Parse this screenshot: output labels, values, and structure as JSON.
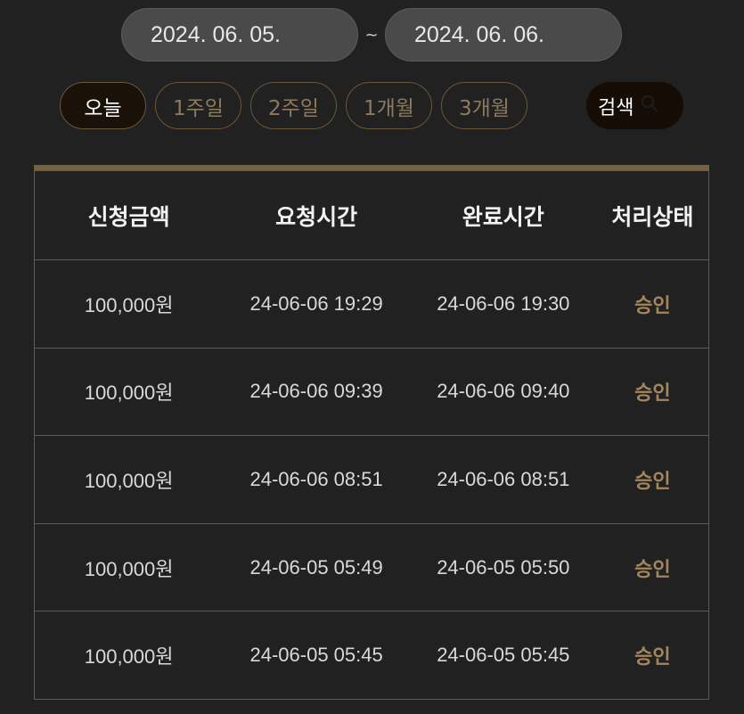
{
  "date_range": {
    "start": "2024. 06. 05.",
    "separator": "~",
    "end": "2024. 06. 06."
  },
  "quick_filters": [
    {
      "label": "오늘",
      "active": true
    },
    {
      "label": "1주일",
      "active": false
    },
    {
      "label": "2주일",
      "active": false
    },
    {
      "label": "1개월",
      "active": false
    },
    {
      "label": "3개월",
      "active": false
    }
  ],
  "search": {
    "label": "검색",
    "icon": "search-icon"
  },
  "table": {
    "headers": [
      "신청금액",
      "요청시간",
      "완료시간",
      "처리상태"
    ],
    "rows": [
      [
        "100,000원",
        "24-06-06 19:29",
        "24-06-06 19:30",
        "승인"
      ],
      [
        "100,000원",
        "24-06-06 09:39",
        "24-06-06 09:40",
        "승인"
      ],
      [
        "100,000원",
        "24-06-06 08:51",
        "24-06-06 08:51",
        "승인"
      ],
      [
        "100,000원",
        "24-06-05 05:49",
        "24-06-05 05:50",
        "승인"
      ],
      [
        "100,000원",
        "24-06-05 05:45",
        "24-06-05 05:45",
        "승인"
      ]
    ]
  },
  "colors": {
    "background": "#212121",
    "accent_gold": "#a3865b",
    "table_top_bar": "#75603f",
    "date_input_bg": "#4a4a4a"
  }
}
